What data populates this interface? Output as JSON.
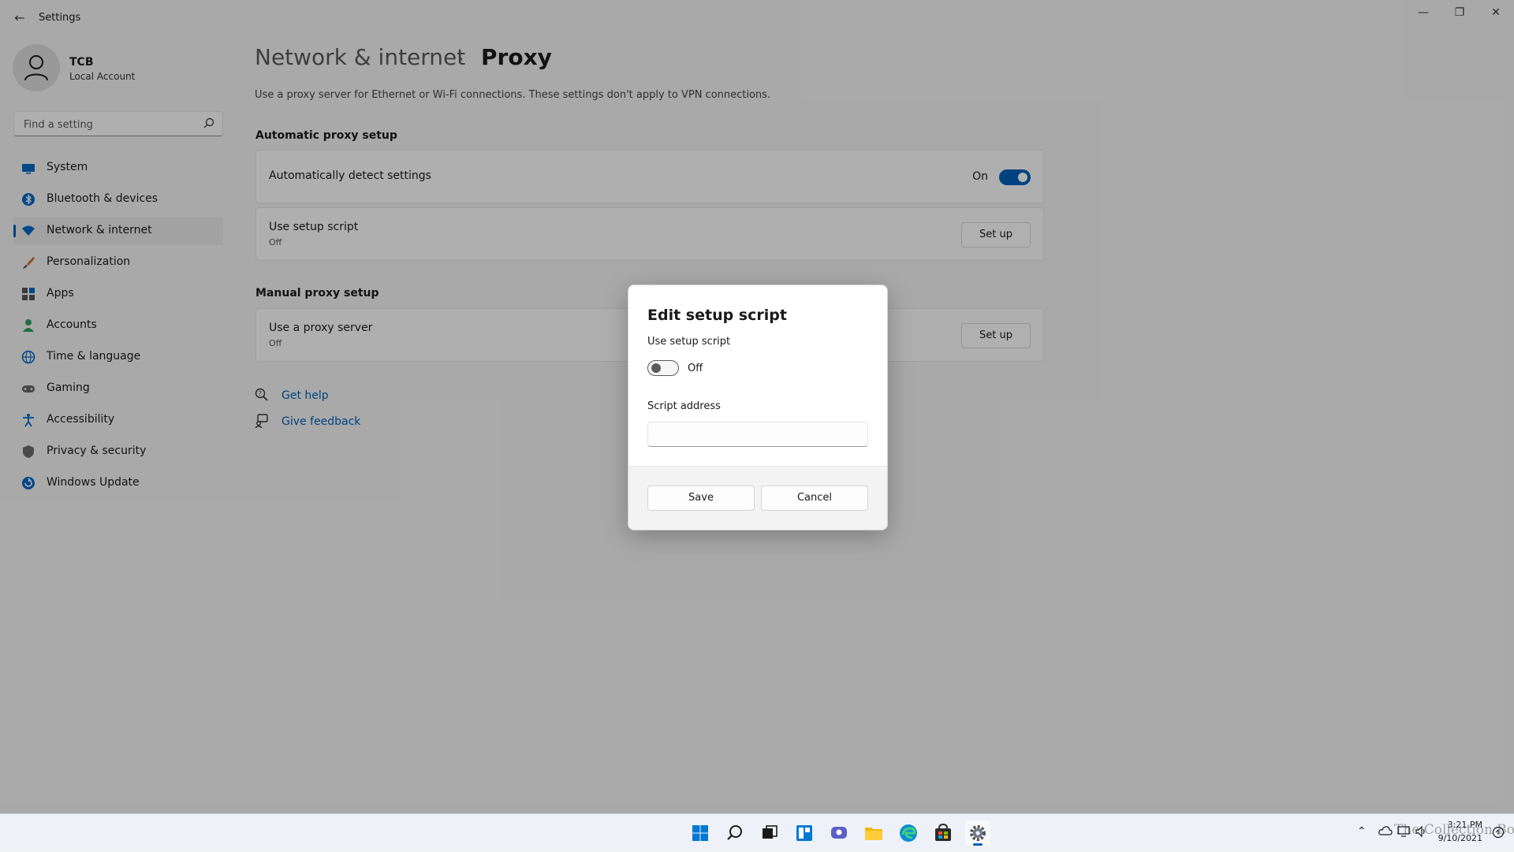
{
  "window": {
    "title": "Settings",
    "controls": [
      "minimize",
      "restore",
      "close"
    ]
  },
  "profile": {
    "name": "TCB",
    "account_type": "Local Account"
  },
  "search": {
    "placeholder": "Find a setting"
  },
  "nav": {
    "items": [
      {
        "label": "System",
        "icon": "system-icon"
      },
      {
        "label": "Bluetooth & devices",
        "icon": "bluetooth-icon"
      },
      {
        "label": "Network & internet",
        "icon": "wifi-icon",
        "active": true
      },
      {
        "label": "Personalization",
        "icon": "brush-icon"
      },
      {
        "label": "Apps",
        "icon": "apps-icon"
      },
      {
        "label": "Accounts",
        "icon": "person-icon"
      },
      {
        "label": "Time & language",
        "icon": "globe-icon"
      },
      {
        "label": "Gaming",
        "icon": "gamepad-icon"
      },
      {
        "label": "Accessibility",
        "icon": "accessibility-icon"
      },
      {
        "label": "Privacy & security",
        "icon": "shield-icon"
      },
      {
        "label": "Windows Update",
        "icon": "update-icon"
      }
    ]
  },
  "breadcrumb": {
    "parent": "Network & internet",
    "separator": "›",
    "current": "Proxy"
  },
  "page": {
    "description": "Use a proxy server for Ethernet or Wi-Fi connections. These settings don't apply to VPN connections.",
    "auto_section": {
      "heading": "Automatic proxy setup",
      "detect": {
        "title": "Automatically detect settings",
        "state": "On"
      },
      "script": {
        "title": "Use setup script",
        "subtitle": "Off",
        "button": "Set up"
      }
    },
    "manual_section": {
      "heading": "Manual proxy setup",
      "proxy": {
        "title": "Use a proxy server",
        "subtitle": "Off",
        "button": "Set up"
      }
    },
    "links": {
      "help": "Get help",
      "feedback": "Give feedback"
    }
  },
  "dialog": {
    "title": "Edit setup script",
    "toggle_label": "Use setup script",
    "toggle_state": "Off",
    "address_label": "Script address",
    "address_value": "",
    "save": "Save",
    "cancel": "Cancel"
  },
  "taskbar": {
    "icons": [
      "windows-start-icon",
      "search-icon",
      "task-view-icon",
      "widgets-icon",
      "chat-icon",
      "file-explorer-icon",
      "edge-icon",
      "store-icon",
      "settings-icon"
    ],
    "time": "3:21 PM",
    "date": "9/10/2021",
    "watermark": "The Collection Book"
  },
  "colors": {
    "accent": "#005fb8",
    "background": "#f3f3f3",
    "card": "#fbfbfb"
  }
}
